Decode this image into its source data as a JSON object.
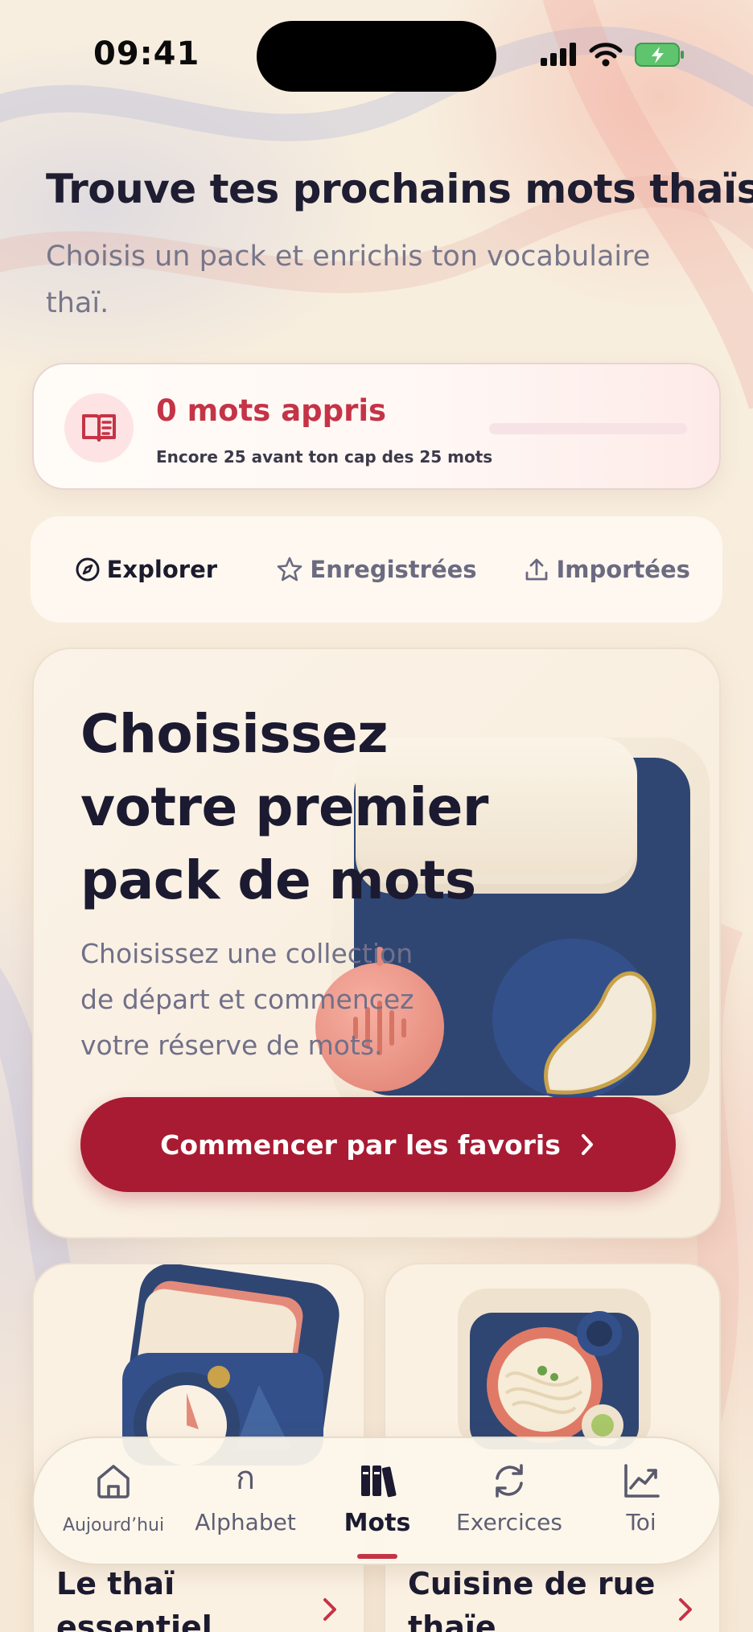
{
  "status_bar": {
    "time": "09:41"
  },
  "header": {
    "title": "Trouve tes prochains mots thaïs",
    "subtitle": "Choisis un pack et enrichis ton vocabulaire thaï."
  },
  "progress": {
    "title": "0 mots appris",
    "caption": "Encore 25 avant ton cap des 25 mots",
    "fraction": 0
  },
  "tabs": [
    {
      "label": "Explorer",
      "icon": "compass-icon",
      "active": true
    },
    {
      "label": "Enregistrées",
      "icon": "star-icon",
      "active": false
    },
    {
      "label": "Importées",
      "icon": "upload-icon",
      "active": false
    }
  ],
  "hero": {
    "title": "Choisissez votre premier pack de mots",
    "text": "Choisissez une collection de départ et commencez votre réserve de mots.",
    "button_label": "Commencer par les favoris"
  },
  "packs": [
    {
      "title": "Le thaï essentiel"
    },
    {
      "title": "Cuisine de rue thaïe"
    }
  ],
  "bottom_nav": [
    {
      "label": "Aujourd’hui",
      "icon": "home-icon"
    },
    {
      "label": "Alphabet",
      "icon": "ก"
    },
    {
      "label": "Mots",
      "icon": "books-icon",
      "active": true
    },
    {
      "label": "Exercices",
      "icon": "refresh-icon"
    },
    {
      "label": "Toi",
      "icon": "chart-icon"
    }
  ],
  "colors": {
    "accent": "#c53346",
    "button": "#a81b32",
    "text_dark": "#1c1b2e",
    "text_muted": "#77768a"
  }
}
